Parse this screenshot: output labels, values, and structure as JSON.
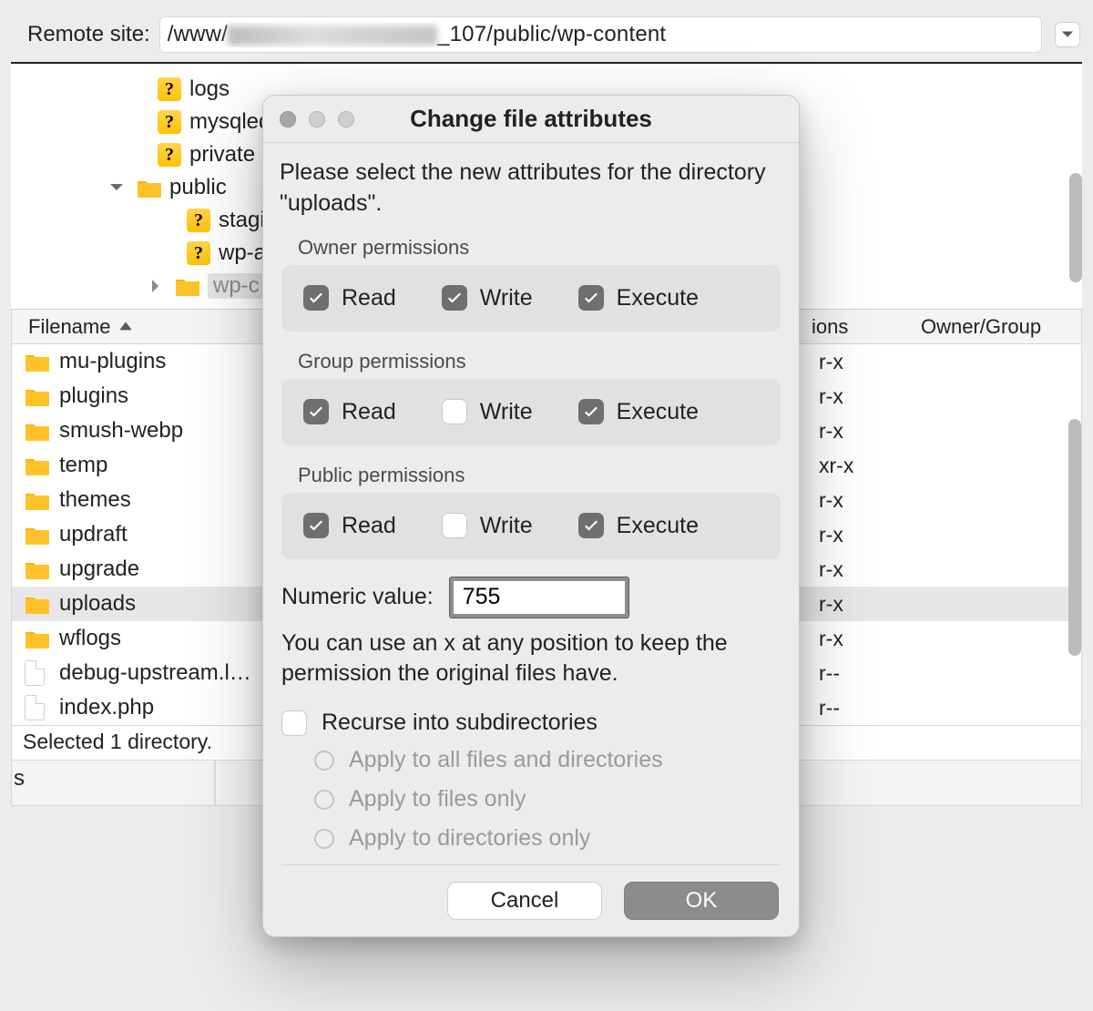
{
  "remote": {
    "label": "Remote site:",
    "path_prefix": "/www/",
    "path_suffix": "_107/public/wp-content"
  },
  "tree": {
    "items": [
      {
        "icon": "q",
        "label": "logs",
        "indent": 0
      },
      {
        "icon": "q",
        "label": "mysqled",
        "indent": 0
      },
      {
        "icon": "q",
        "label": "private",
        "indent": 0
      },
      {
        "icon": "folder",
        "label": "public",
        "indent": 0,
        "expand": "down"
      },
      {
        "icon": "q",
        "label": "stagi",
        "indent": 1
      },
      {
        "icon": "q",
        "label": "wp-a",
        "indent": 1
      },
      {
        "icon": "folder",
        "label": "wp-c",
        "indent": 1,
        "expand": "right",
        "selected": true
      }
    ]
  },
  "list": {
    "columns": {
      "filename": "Filename",
      "perm_suffix": "ions",
      "owner": "Owner/Group"
    },
    "rows": [
      {
        "icon": "folder",
        "name": "mu-plugins",
        "perm": "r-x"
      },
      {
        "icon": "folder",
        "name": "plugins",
        "perm": "r-x"
      },
      {
        "icon": "folder",
        "name": "smush-webp",
        "perm": "r-x"
      },
      {
        "icon": "folder",
        "name": "temp",
        "perm": "xr-x"
      },
      {
        "icon": "folder",
        "name": "themes",
        "perm": "r-x"
      },
      {
        "icon": "folder",
        "name": "updraft",
        "perm": "r-x"
      },
      {
        "icon": "folder",
        "name": "upgrade",
        "perm": "r-x"
      },
      {
        "icon": "folder",
        "name": "uploads",
        "perm": "r-x",
        "selected": true
      },
      {
        "icon": "folder",
        "name": "wflogs",
        "perm": "r-x"
      },
      {
        "icon": "file",
        "name": "debug-upstream.l…",
        "perm": "r--"
      },
      {
        "icon": "file",
        "name": "index.php",
        "perm": "r--"
      }
    ]
  },
  "status": "Selected 1 directory.",
  "bottom_char": "s",
  "dialog": {
    "title": "Change file attributes",
    "intro": "Please select the new attributes for the directory \"uploads\".",
    "groups": {
      "owner": {
        "label": "Owner permissions",
        "read": true,
        "write": true,
        "execute": true
      },
      "group": {
        "label": "Group permissions",
        "read": true,
        "write": false,
        "execute": true
      },
      "public": {
        "label": "Public permissions",
        "read": true,
        "write": false,
        "execute": true
      }
    },
    "perm_labels": {
      "read": "Read",
      "write": "Write",
      "execute": "Execute"
    },
    "numeric_label": "Numeric value:",
    "numeric_value": "755",
    "hint": "You can use an x at any position to keep the permission the original files have.",
    "recurse_label": "Recurse into subdirectories",
    "radios": [
      "Apply to all files and directories",
      "Apply to files only",
      "Apply to directories only"
    ],
    "buttons": {
      "cancel": "Cancel",
      "ok": "OK"
    }
  }
}
